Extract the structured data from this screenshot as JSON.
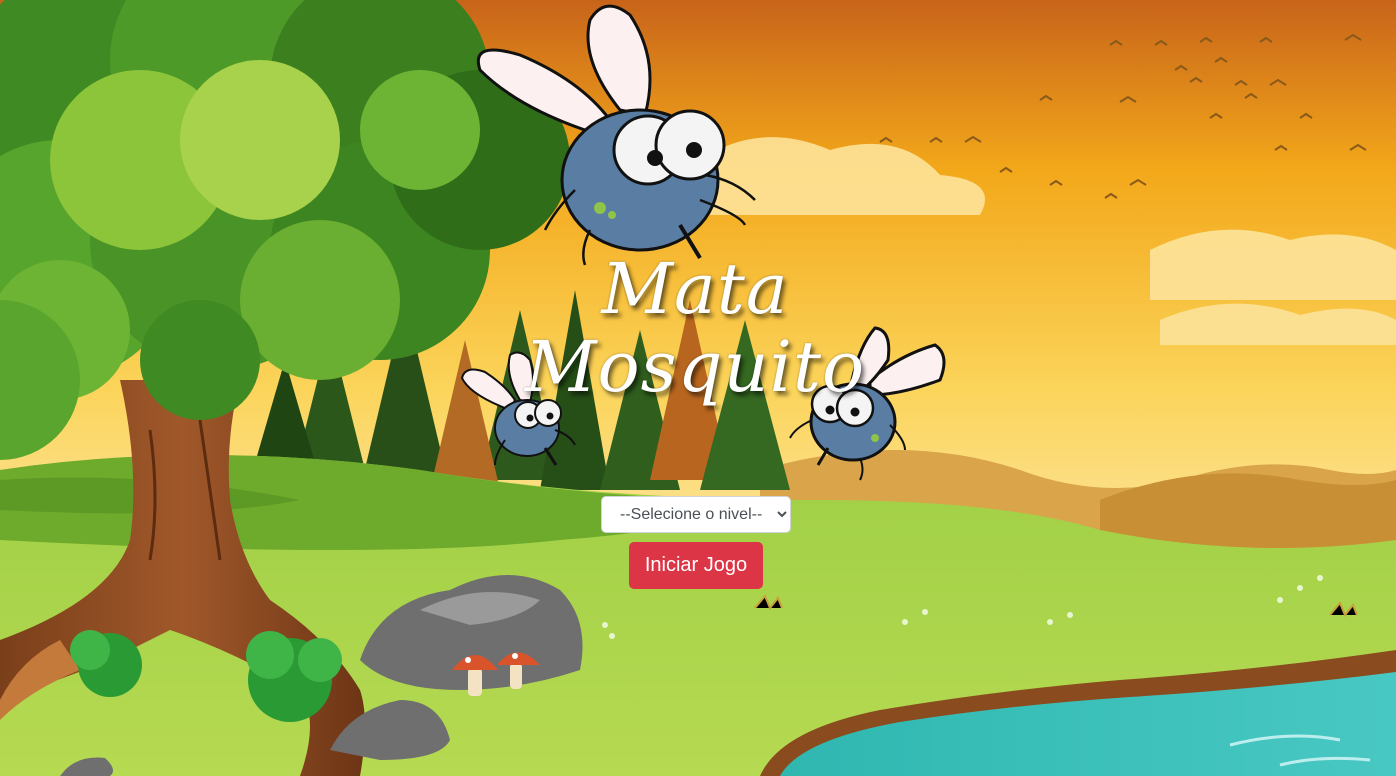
{
  "game": {
    "title_line1": "Mata",
    "title_line2": "Mosquito"
  },
  "level_select": {
    "selected": "--Selecione o nivel--",
    "options": [
      "--Selecione o nivel--"
    ]
  },
  "start_button": {
    "label": "Iniciar Jogo",
    "color": "#dc3545"
  },
  "icons": [
    "mosquito-icon",
    "chevron-down-icon"
  ]
}
